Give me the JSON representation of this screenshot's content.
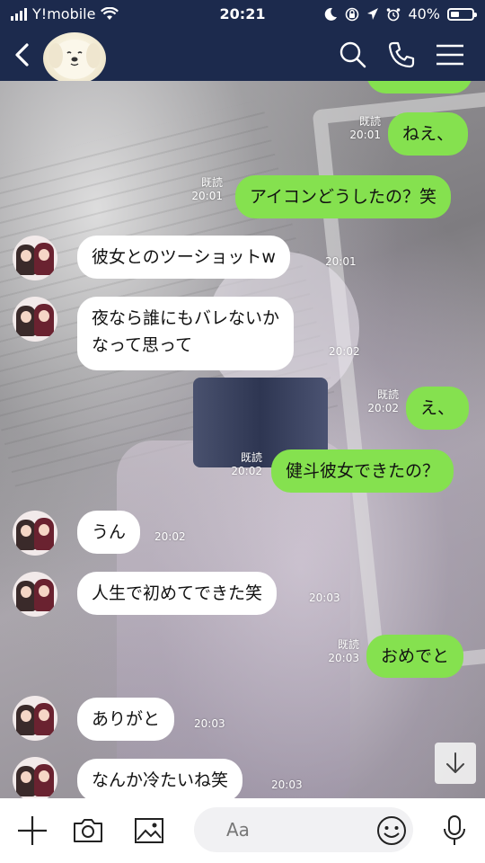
{
  "status_bar": {
    "carrier": "Y!mobile",
    "time": "20:21",
    "battery_percent": "40%",
    "battery_level": 0.4
  },
  "nav": {
    "icons": [
      "back-icon",
      "search-icon",
      "phone-icon",
      "menu-icon"
    ]
  },
  "messages": [
    {
      "side": "out",
      "text": "ねえ、",
      "read": "既読",
      "time": "20:01"
    },
    {
      "side": "out",
      "text": "アイコンどうしたの？笑",
      "read": "既読",
      "time": "20:01"
    },
    {
      "side": "in",
      "text": "彼女とのツーショットw",
      "time": "20:01"
    },
    {
      "side": "in",
      "text": "夜なら誰にもバレないか",
      "text2": "なって思って",
      "time": "20:02"
    },
    {
      "side": "out",
      "text": "え、",
      "read": "既読",
      "time": "20:02"
    },
    {
      "side": "out",
      "text": "健斗彼女できたの？",
      "read": "既読",
      "time": "20:02"
    },
    {
      "side": "in",
      "text": "うん",
      "time": "20:02"
    },
    {
      "side": "in",
      "text": "人生で初めてできた笑",
      "time": "20:03"
    },
    {
      "side": "out",
      "text": "おめでと",
      "read": "既読",
      "time": "20:03"
    },
    {
      "side": "in",
      "text": "ありがと",
      "time": "20:03"
    },
    {
      "side": "in",
      "text": "なんか冷たいね笑",
      "time": "20:03"
    }
  ],
  "input_bar": {
    "placeholder": "Aa",
    "icons": [
      "plus-icon",
      "camera-icon",
      "image-icon",
      "emoji-icon",
      "microphone-icon"
    ]
  },
  "colors": {
    "header_bg": "#1c2a4d",
    "outgoing_bubble": "#85e14f",
    "incoming_bubble": "#ffffff"
  }
}
